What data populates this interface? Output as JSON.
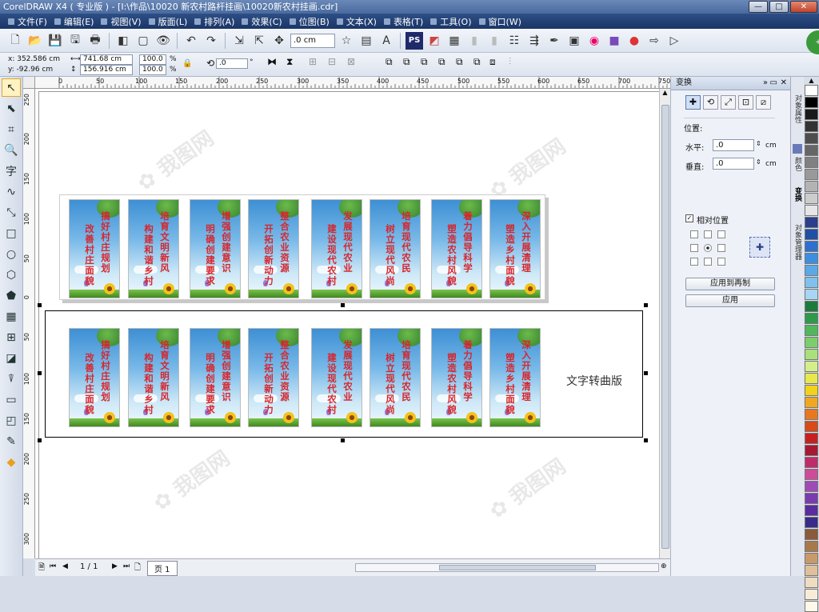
{
  "window": {
    "title": "CorelDRAW X4 ( 专业版 ) - [I:\\作品\\10020 新农村路杆挂画\\10020新农村挂画.cdr]",
    "min": "—",
    "max": "□",
    "close": "✕"
  },
  "menu": [
    "文件(F)",
    "编辑(E)",
    "视图(V)",
    "版面(L)",
    "排列(A)",
    "效果(C)",
    "位图(B)",
    "文本(X)",
    "表格(T)",
    "工具(O)",
    "窗口(W)"
  ],
  "toolbar": {
    "nudge": ".0 cm"
  },
  "propbar": {
    "x": "x: 352.586 cm",
    "y": "y: -92.96 cm",
    "w": "741.68 cm",
    "h": "156.916 cm",
    "scale_x": "100.0",
    "scale_y": "100.0",
    "pct": "%",
    "angle": ".0",
    "deg": "°"
  },
  "ruler_h": [
    "0",
    "50",
    "100",
    "150",
    "200",
    "250",
    "300",
    "350",
    "400",
    "450",
    "500",
    "550",
    "600",
    "650",
    "700",
    "750"
  ],
  "ruler_v": [
    "250",
    "200",
    "150",
    "100",
    "50",
    "0",
    "50",
    "100",
    "150",
    "200",
    "250",
    "300"
  ],
  "banners_top": [
    {
      "c1": "搞好村庄规划",
      "c2": "改善村庄面貌"
    },
    {
      "c1": "培育文明新风",
      "c2": "构建和谐乡村"
    },
    {
      "c1": "增强创建意识",
      "c2": "明确创建要求"
    },
    {
      "c1": "整合农业资源",
      "c2": "开拓创新动力"
    },
    {
      "c1": "发展现代农业",
      "c2": "建设现代农村"
    },
    {
      "c1": "培育现代农民",
      "c2": "树立现代风尚"
    },
    {
      "c1": "着力倡导科学",
      "c2": "塑造农村风貌"
    },
    {
      "c1": "深入开展清理",
      "c2": "塑造乡村面貌"
    }
  ],
  "canvas_label": "文字转曲版",
  "panel": {
    "title": "变换",
    "position_label": "位置:",
    "h_label": "水平:",
    "h_value": ".0",
    "h_unit": "cm",
    "v_label": "垂直:",
    "v_value": ".0",
    "v_unit": "cm",
    "relative": "相对位置",
    "apply_dup": "应用到再制",
    "apply": "应用"
  },
  "dockers": [
    "对象属性",
    "颜色",
    "变换",
    "对象管理器"
  ],
  "statusbar": {
    "page_count": "1 / 1",
    "page_tab": "页 1"
  },
  "palette": [
    "#ffffff",
    "#000000",
    "#1a1a1a",
    "#333333",
    "#4d4d4d",
    "#666666",
    "#808080",
    "#999999",
    "#b3b3b3",
    "#cccccc",
    "#e6e6e6",
    "#2b3f8c",
    "#1f4fa6",
    "#2f6fd0",
    "#3c8fe0",
    "#5aa8e8",
    "#7ec0ee",
    "#a6d6f4",
    "#1b7a3c",
    "#2e9a4a",
    "#4fb85a",
    "#7cce6a",
    "#a8e07a",
    "#d4ee8a",
    "#e8e84a",
    "#f2d21a",
    "#f0a820",
    "#e87820",
    "#d84a1a",
    "#c82020",
    "#a81830",
    "#c02c6a",
    "#d04a9a",
    "#a04ab8",
    "#7a3ab0",
    "#5a2aa0",
    "#3a2a8a",
    "#8a5a3a",
    "#a87a4a",
    "#c89a6a",
    "#e0c09a",
    "#f0dcc0",
    "#f8ecd8",
    "#fff8e8"
  ]
}
